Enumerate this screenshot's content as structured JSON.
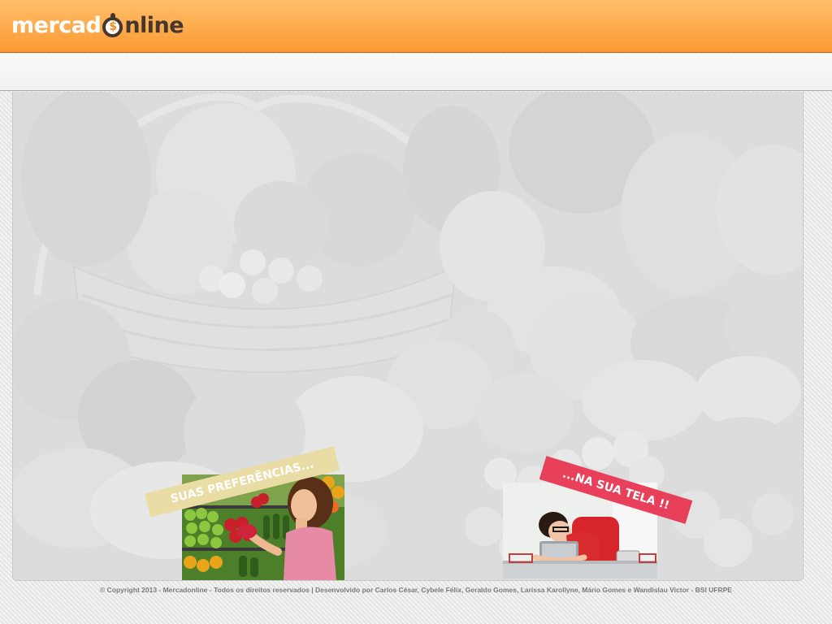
{
  "header": {
    "logo_part1": "mercad",
    "logo_dollar": "$",
    "logo_part2": "nline"
  },
  "promos": {
    "preferences_banner": "SUAS PREFERÊNCIAS...",
    "screen_banner": "...NA SUA TELA !!"
  },
  "footer": {
    "copyright": "© Copyright 2013 - Mercadonline - Todos os direitos reservados | Desenvolvido por Carlos César, Cybele Félix, Geraldo Gomes, Larissa Karollyne, Mário Gomes e Wandislau Victor - BSI UFRPE"
  },
  "colors": {
    "brand_orange": "#fb9a33",
    "brand_dark": "#46372c",
    "banner_beige": "#e9dca4",
    "banner_red": "#e8405a"
  }
}
